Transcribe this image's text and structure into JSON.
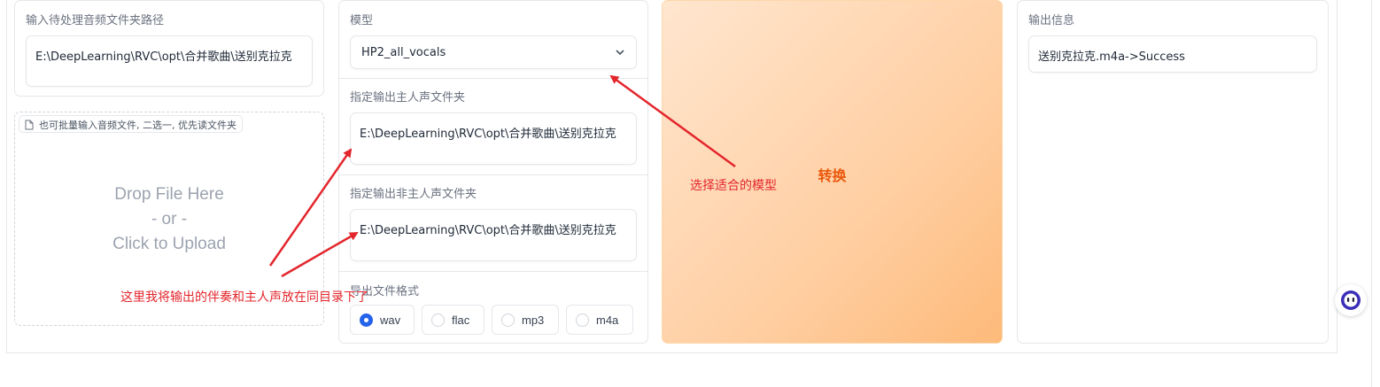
{
  "input_folder": {
    "label": "输入待处理音频文件夹路径",
    "value": "E:\\DeepLearning\\RVC\\opt\\合并歌曲\\送别克拉克"
  },
  "upload": {
    "chip_label": "也可批量输入音频文件, 二选一, 优先读文件夹",
    "drop_line1": "Drop File Here",
    "drop_line2": "- or -",
    "drop_line3": "Click to Upload"
  },
  "model": {
    "label": "模型",
    "selected": "HP2_all_vocals"
  },
  "vocal_out": {
    "label": "指定输出主人声文件夹",
    "value": "E:\\DeepLearning\\RVC\\opt\\合并歌曲\\送别克拉克"
  },
  "inst_out": {
    "label": "指定输出非主人声文件夹",
    "value": "E:\\DeepLearning\\RVC\\opt\\合并歌曲\\送别克拉克"
  },
  "format": {
    "label": "导出文件格式",
    "options": [
      "wav",
      "flac",
      "mp3",
      "m4a"
    ],
    "selected": "wav"
  },
  "convert": {
    "label": "转换"
  },
  "output": {
    "label": "输出信息",
    "value": "送别克拉克.m4a->Success"
  },
  "annotations": {
    "model_note": "选择适合的模型",
    "folder_note": "这里我将输出的伴奏和主人声放在同目录下了"
  },
  "colors": {
    "accent": "#2563eb",
    "convert_text": "#ea580c",
    "annotation": "#e3262c"
  }
}
